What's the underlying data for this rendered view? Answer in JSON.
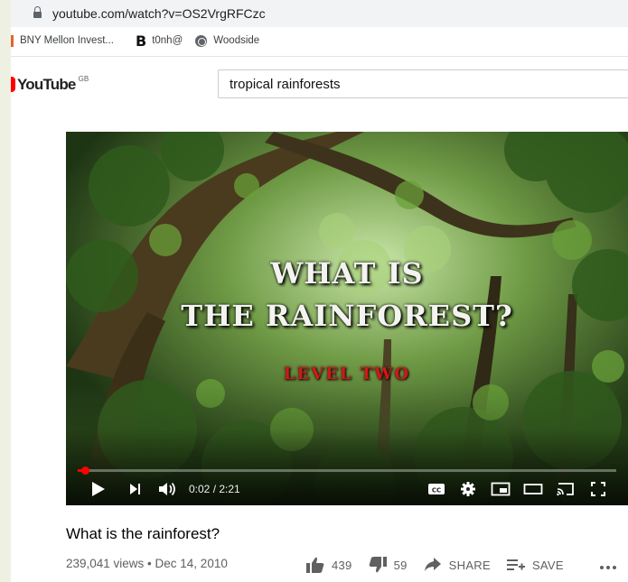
{
  "browser": {
    "url": "youtube.com/watch?v=OS2VrgRFCzc",
    "bookmarks": [
      {
        "label": "BNY Mellon Invest..."
      },
      {
        "label": "t0nh@"
      },
      {
        "label": "Woodside"
      }
    ]
  },
  "youtube": {
    "logo_text": "YouTube",
    "region": "GB",
    "search_value": "tropical rainforests"
  },
  "player": {
    "overlay_line1": "WHAT IS",
    "overlay_line2": "THE RAINFOREST?",
    "overlay_line3": "LEVEL TWO",
    "time": "0:02 / 2:21",
    "progress_fraction": 0.014
  },
  "video": {
    "title": "What is the rainforest?",
    "meta": "239,041 views • Dec 14, 2010",
    "likes": "439",
    "dislikes": "59",
    "share_label": "SHARE",
    "save_label": "SAVE"
  }
}
